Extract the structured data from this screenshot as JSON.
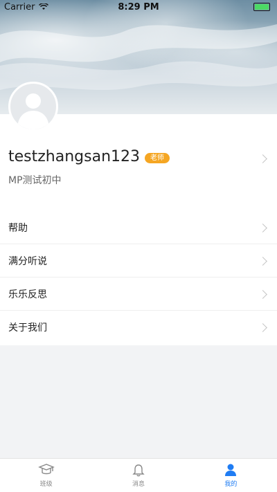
{
  "status_bar": {
    "carrier": "Carrier",
    "time": "8:29 PM"
  },
  "profile": {
    "name": "testzhangsan123",
    "badge": "老师",
    "school": "MP测试初中"
  },
  "menu": [
    {
      "label": "帮助"
    },
    {
      "label": "满分听说"
    },
    {
      "label": "乐乐反思"
    },
    {
      "label": "关于我们"
    }
  ],
  "tabs": [
    {
      "label": "班级",
      "icon": "graduation-cap-icon",
      "active": false
    },
    {
      "label": "消息",
      "icon": "bell-icon",
      "active": false
    },
    {
      "label": "我的",
      "icon": "person-icon",
      "active": true
    }
  ],
  "colors": {
    "accent": "#1f7cf3",
    "badge": "#f5a623"
  }
}
